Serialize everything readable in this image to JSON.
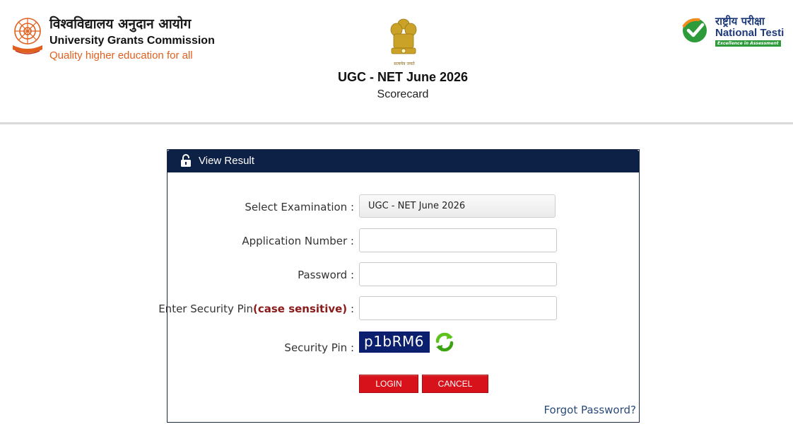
{
  "header": {
    "ugc_hindi": "विश्वविद्यालय अनुदान आयोग",
    "ugc_name": "University Grants Commission",
    "ugc_tagline": "Quality higher education for all",
    "emblem_motto": "सत्यमेव जयते",
    "title": "UGC - NET June 2026",
    "subtitle": "Scorecard",
    "nta_hindi": "राष्ट्रीय परीक्षा",
    "nta_name": "National Testi",
    "nta_tagline": "Excellence in Assessment"
  },
  "panel": {
    "title": "View Result",
    "fields": {
      "exam_label": "Select Examination :",
      "exam_value": "UGC - NET June 2026",
      "app_label": "Application Number :",
      "app_value": "",
      "password_label": "Password :",
      "password_value": "",
      "pin_label": "Enter Security Pin",
      "pin_label_hint": "(case sensitive)",
      "pin_label_colon": " :",
      "pin_value": "",
      "captcha_label": "Security Pin :",
      "captcha_value": "p1bRM6"
    },
    "login_label": "LOGIN",
    "cancel_label": "CANCEL",
    "forgot_label": "Forgot Password?"
  },
  "colors": {
    "panel_header": "#0d2045",
    "button": "#d8121a",
    "captcha_bg": "#0b1f6e",
    "ugc_orange": "#e0601f",
    "nta_blue": "#1f3a7a",
    "nta_green": "#2e9b3a"
  },
  "icons": [
    "ugc-emblem-icon",
    "national-emblem-icon",
    "nta-check-icon",
    "lock-icon",
    "refresh-icon"
  ]
}
